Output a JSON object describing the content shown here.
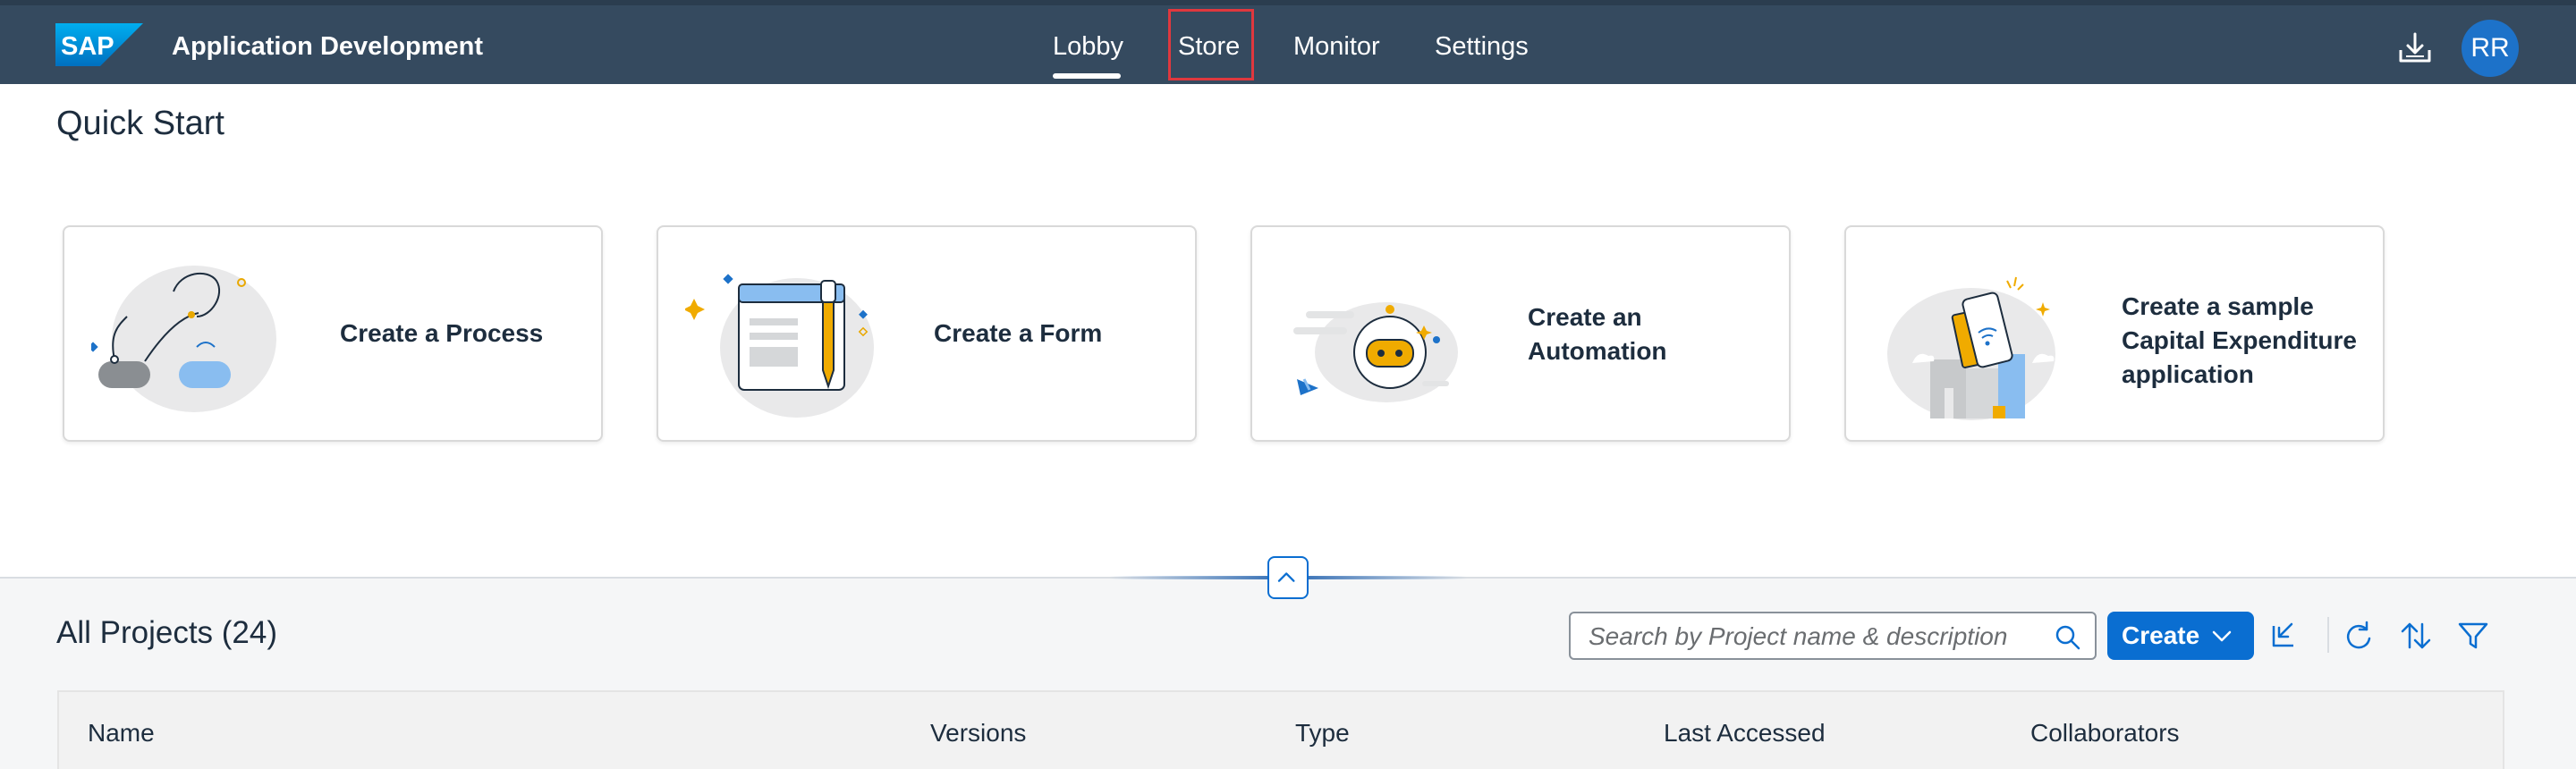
{
  "shell": {
    "logo_text": "SAP",
    "app_title": "Application Development",
    "nav": [
      {
        "label": "Lobby",
        "active": true
      },
      {
        "label": "Store",
        "highlighted": true
      },
      {
        "label": "Monitor"
      },
      {
        "label": "Settings"
      }
    ],
    "avatar_initials": "RR",
    "download_icon": "download-icon"
  },
  "quick_start": {
    "title": "Quick Start",
    "cards": [
      {
        "label_lines": [
          "Create a Process"
        ],
        "icon": "process-illustration"
      },
      {
        "label_lines": [
          "Create a Form"
        ],
        "icon": "form-illustration"
      },
      {
        "label_lines": [
          "Create an",
          "Automation"
        ],
        "icon": "automation-illustration"
      },
      {
        "label_lines": [
          "Create a sample",
          "Capital Expenditure",
          "application"
        ],
        "icon": "sample-app-illustration"
      }
    ]
  },
  "projects": {
    "title": "All Projects (24)",
    "search_placeholder": "Search by Project name & description",
    "create_label": "Create",
    "toolbar_icons": [
      "import-icon",
      "refresh-icon",
      "sort-icon",
      "filter-icon"
    ],
    "columns": [
      "Name",
      "Versions",
      "Type",
      "Last Accessed",
      "Collaborators"
    ]
  },
  "colors": {
    "shell_bg": "#354a5f",
    "accent": "#0a6ed1",
    "avatar": "#1d72c9",
    "highlight_box": "#e0383e"
  }
}
